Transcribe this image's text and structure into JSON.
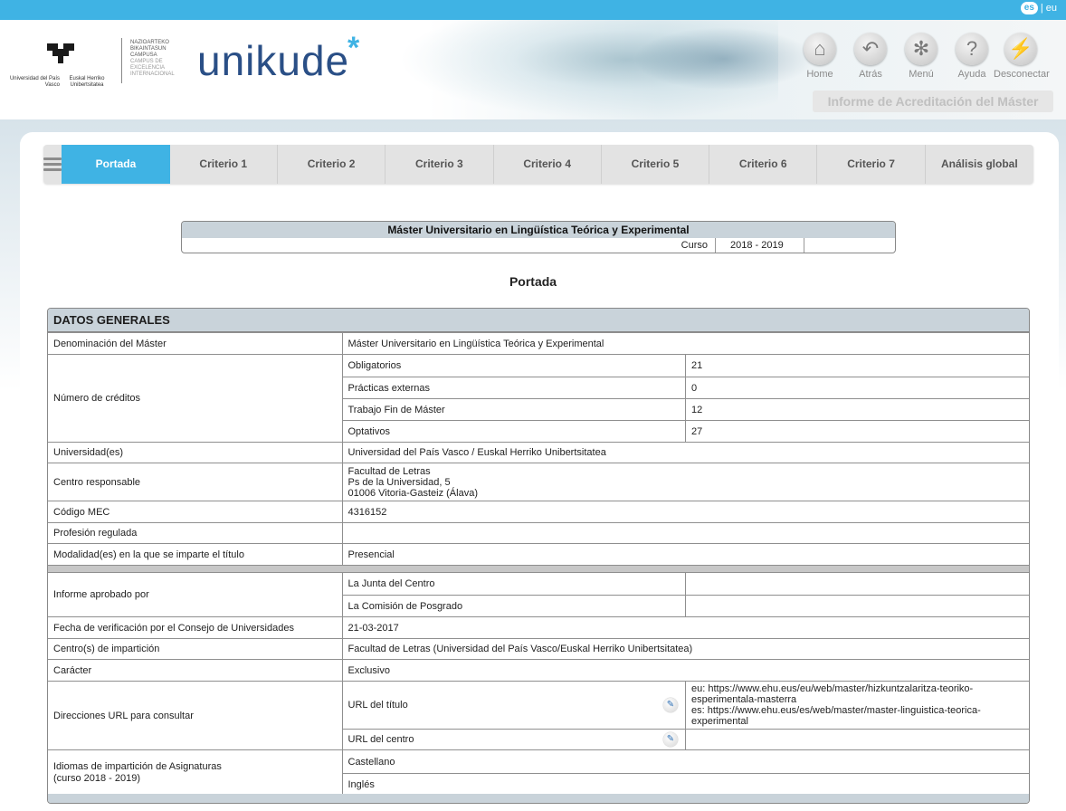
{
  "lang": {
    "es": "es",
    "sep": "|",
    "eu": "eu"
  },
  "logos": {
    "ehu_left": "Universidad del País Vasco",
    "ehu_right": "Euskal Herriko Unibertsitatea",
    "campus_1": "NAZIOARTEKO BIKAINTASUN CAMPUSA",
    "campus_2": "CAMPUS DE EXCELENCIA INTERNACIONAL",
    "app_name": "unikude",
    "app_star": "*"
  },
  "nav": [
    {
      "label": "Home",
      "icon": "home-icon",
      "glyph": "⌂"
    },
    {
      "label": "Atrás",
      "icon": "back-arrow-icon",
      "glyph": "↶"
    },
    {
      "label": "Menú",
      "icon": "asterisk-menu-icon",
      "glyph": "✻"
    },
    {
      "label": "Ayuda",
      "icon": "help-icon",
      "glyph": "?"
    },
    {
      "label": "Desconectar",
      "icon": "lightning-icon",
      "glyph": "⚡"
    }
  ],
  "report_title": "Informe de Acreditación del Máster",
  "tabs": [
    "Portada",
    "Criterio 1",
    "Criterio 2",
    "Criterio 3",
    "Criterio 4",
    "Criterio 5",
    "Criterio 6",
    "Criterio 7",
    "Análisis global"
  ],
  "active_tab": "Portada",
  "master": {
    "title": "Máster Universitario en Lingüística Teórica y Experimental",
    "curso_label": "Curso",
    "curso_value": "2018  -  2019"
  },
  "section_heading": "Portada",
  "datos": {
    "header": "DATOS GENERALES",
    "denominacion_label": "Denominación del Máster",
    "denominacion_value": "Máster Universitario en Lingüística Teórica y Experimental",
    "creditos_label": "Número de créditos",
    "creditos": [
      {
        "label": "Obligatorios",
        "value": "21"
      },
      {
        "label": "Prácticas externas",
        "value": "0"
      },
      {
        "label": "Trabajo Fin de Máster",
        "value": "12"
      },
      {
        "label": "Optativos",
        "value": "27"
      }
    ],
    "universidad_label": "Universidad(es)",
    "universidad_value": "Universidad del País Vasco / Euskal Herriko Unibertsitatea",
    "centro_label": "Centro responsable",
    "centro_line1": "Facultad de Letras",
    "centro_line2": "Ps de la Universidad, 5",
    "centro_line3": "01006  Vitoria-Gasteiz  (Álava)",
    "codigo_label": "Código MEC",
    "codigo_value": "4316152",
    "profesion_label": "Profesión regulada",
    "profesion_value": "",
    "modalidad_label": "Modalidad(es) en la que se imparte el título",
    "modalidad_value": "Presencial",
    "informe_label": "Informe aprobado por",
    "informe_1": "La Junta del Centro",
    "informe_2": "La Comisión de Posgrado",
    "fecha_label": "Fecha de verificación por el Consejo de Universidades",
    "fecha_value": "21-03-2017",
    "centros_label": "Centro(s) de impartición",
    "centros_value": "Facultad de Letras  (Universidad del País Vasco/Euskal Herriko Unibertsitatea)",
    "caracter_label": "Carácter",
    "caracter_value": "Exclusivo",
    "urls_label": "Direcciones URL para consultar",
    "url_titulo_label": "URL del título",
    "url_titulo_eu": "eu: https://www.ehu.eus/eu/web/master/hizkuntzalaritza-teoriko-esperimentala-masterra",
    "url_titulo_es": "es: https://www.ehu.eus/es/web/master/master-linguistica-teorica-experimental",
    "url_centro_label": "URL del centro",
    "idiomas_label_1": "Idiomas de impartición de Asignaturas",
    "idiomas_label_2": "(curso 2018  -  2019)",
    "idioma_1": "Castellano",
    "idioma_2": "Inglés"
  }
}
